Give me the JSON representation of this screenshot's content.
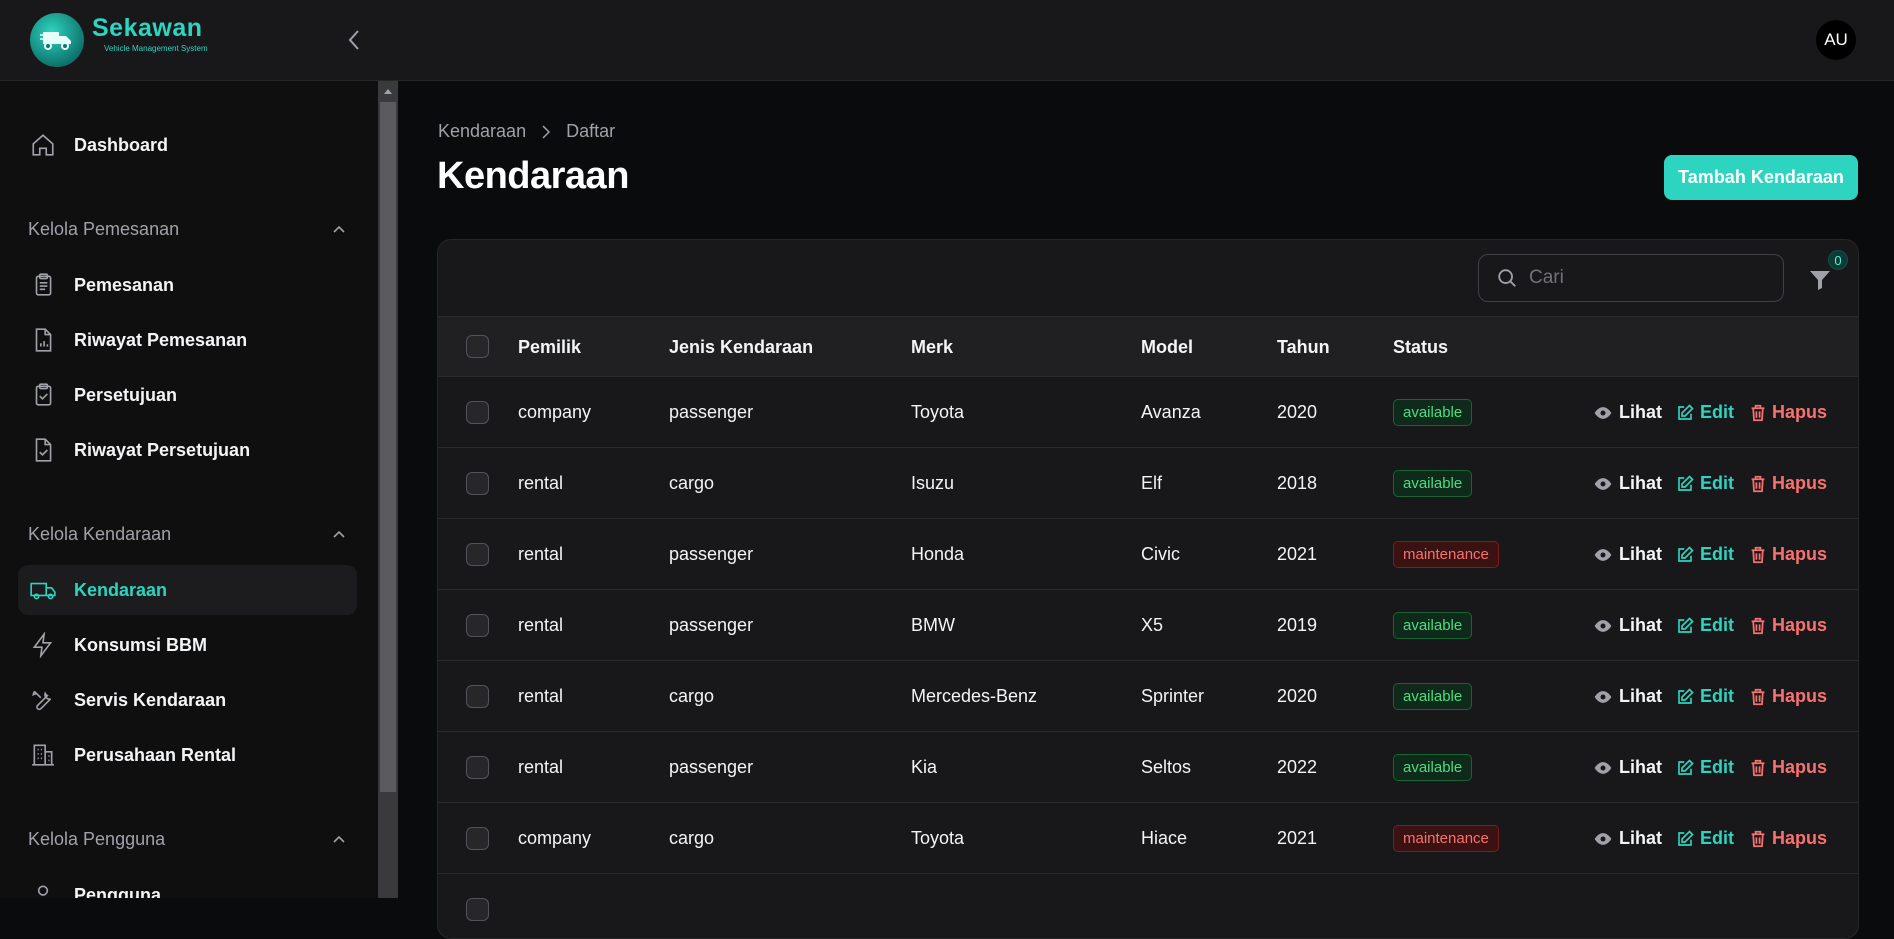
{
  "app": {
    "brand_name": "Sekawan",
    "brand_subtitle": "Vehicle Management System",
    "avatar_initials": "AU"
  },
  "sidebar": {
    "dashboard": "Dashboard",
    "groups": [
      {
        "label": "Kelola Pemesanan",
        "items": [
          "Pemesanan",
          "Riwayat Pemesanan",
          "Persetujuan",
          "Riwayat Persetujuan"
        ]
      },
      {
        "label": "Kelola Kendaraan",
        "items": [
          "Kendaraan",
          "Konsumsi BBM",
          "Servis Kendaraan",
          "Perusahaan Rental"
        ]
      },
      {
        "label": "Kelola Pengguna",
        "items": [
          "Pengguna"
        ]
      }
    ],
    "active_item": "Kendaraan"
  },
  "breadcrumb": [
    "Kendaraan",
    "Daftar"
  ],
  "page_title": "Kendaraan",
  "add_button": "Tambah Kendaraan",
  "search": {
    "placeholder": "Cari"
  },
  "filter_count": "0",
  "table": {
    "columns": [
      "Pemilik",
      "Jenis Kendaraan",
      "Merk",
      "Model",
      "Tahun",
      "Status"
    ],
    "rows": [
      {
        "owner": "company",
        "type": "passenger",
        "brand": "Toyota",
        "model": "Avanza",
        "year": "2020",
        "status": "available"
      },
      {
        "owner": "rental",
        "type": "cargo",
        "brand": "Isuzu",
        "model": "Elf",
        "year": "2018",
        "status": "available"
      },
      {
        "owner": "rental",
        "type": "passenger",
        "brand": "Honda",
        "model": "Civic",
        "year": "2021",
        "status": "maintenance"
      },
      {
        "owner": "rental",
        "type": "passenger",
        "brand": "BMW",
        "model": "X5",
        "year": "2019",
        "status": "available"
      },
      {
        "owner": "rental",
        "type": "cargo",
        "brand": "Mercedes-Benz",
        "model": "Sprinter",
        "year": "2020",
        "status": "available"
      },
      {
        "owner": "rental",
        "type": "passenger",
        "brand": "Kia",
        "model": "Seltos",
        "year": "2022",
        "status": "available"
      },
      {
        "owner": "company",
        "type": "cargo",
        "brand": "Toyota",
        "model": "Hiace",
        "year": "2021",
        "status": "maintenance"
      }
    ],
    "actions": {
      "view": "Lihat",
      "edit": "Edit",
      "delete": "Hapus"
    }
  },
  "colors": {
    "accent": "#2dd4bf",
    "available": "#4ade80",
    "maintenance": "#f87171"
  }
}
